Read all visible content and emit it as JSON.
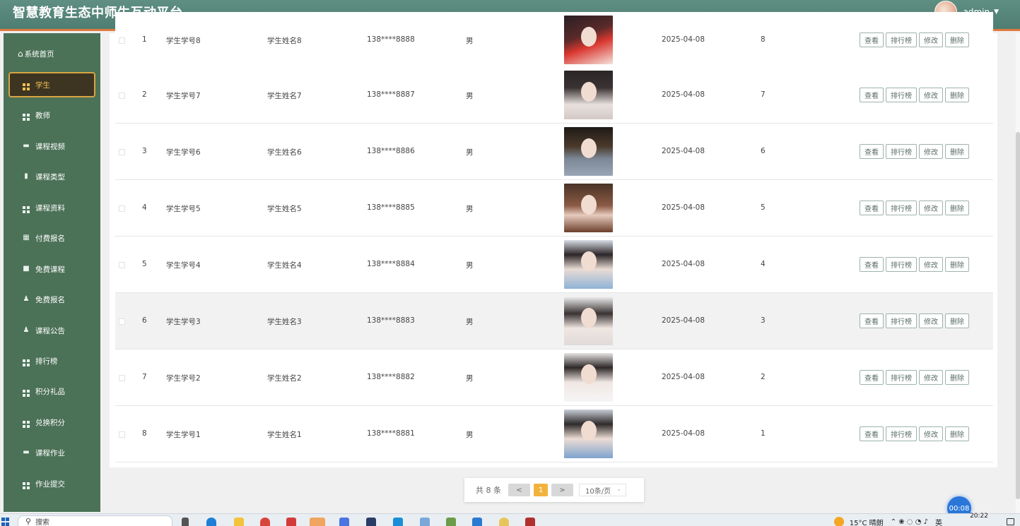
{
  "header": {
    "title": "智慧教育生态中师生互动平台",
    "username": "admin"
  },
  "sidebar": {
    "home": "系统首页",
    "items": [
      {
        "label": "学生",
        "icon": "grid-icon",
        "active": true
      },
      {
        "label": "教师",
        "icon": "grid-icon"
      },
      {
        "label": "课程视频",
        "icon": "briefcase-icon"
      },
      {
        "label": "课程类型",
        "icon": "clipboard-icon"
      },
      {
        "label": "课程资料",
        "icon": "grid-icon"
      },
      {
        "label": "付费报名",
        "icon": "table-icon"
      },
      {
        "label": "免费课程",
        "icon": "chat-icon"
      },
      {
        "label": "免费报名",
        "icon": "user-icon"
      },
      {
        "label": "课程公告",
        "icon": "user-icon"
      },
      {
        "label": "排行榜",
        "icon": "grid-icon"
      },
      {
        "label": "积分礼品",
        "icon": "grid-icon"
      },
      {
        "label": "兑换积分",
        "icon": "grid-icon"
      },
      {
        "label": "课程作业",
        "icon": "ticket-icon"
      },
      {
        "label": "作业提交",
        "icon": "grid-icon"
      }
    ]
  },
  "table": {
    "actions": {
      "view": "查看",
      "rank": "排行榜",
      "edit": "修改",
      "delete": "删除"
    },
    "rows": [
      {
        "index": "1",
        "student_no": "学生学号8",
        "name": "学生姓名8",
        "phone": "138****8888",
        "gender": "男",
        "date": "2025-04-08",
        "points": "8"
      },
      {
        "index": "2",
        "student_no": "学生学号7",
        "name": "学生姓名7",
        "phone": "138****8887",
        "gender": "男",
        "date": "2025-04-08",
        "points": "7"
      },
      {
        "index": "3",
        "student_no": "学生学号6",
        "name": "学生姓名6",
        "phone": "138****8886",
        "gender": "男",
        "date": "2025-04-08",
        "points": "6"
      },
      {
        "index": "4",
        "student_no": "学生学号5",
        "name": "学生姓名5",
        "phone": "138****8885",
        "gender": "男",
        "date": "2025-04-08",
        "points": "5"
      },
      {
        "index": "5",
        "student_no": "学生学号4",
        "name": "学生姓名4",
        "phone": "138****8884",
        "gender": "男",
        "date": "2025-04-08",
        "points": "4"
      },
      {
        "index": "6",
        "student_no": "学生学号3",
        "name": "学生姓名3",
        "phone": "138****8883",
        "gender": "男",
        "date": "2025-04-08",
        "points": "3"
      },
      {
        "index": "7",
        "student_no": "学生学号2",
        "name": "学生姓名2",
        "phone": "138****8882",
        "gender": "男",
        "date": "2025-04-08",
        "points": "2"
      },
      {
        "index": "8",
        "student_no": "学生学号1",
        "name": "学生姓名1",
        "phone": "138****8881",
        "gender": "男",
        "date": "2025-04-08",
        "points": "1"
      }
    ]
  },
  "pagination": {
    "total": "共 8 条",
    "prev": "<",
    "current": "1",
    "next": ">",
    "page_size": "10条/页"
  },
  "timer": "00:08",
  "taskbar": {
    "search": "搜索",
    "weather": "15°C 晴朗",
    "time": "20:22",
    "ime": "英"
  },
  "colors": {
    "header_bg": "#4f7d72",
    "header_border": "#e07a3c",
    "sidebar_bg": "#4b7157",
    "active_item": "#f3c152",
    "pager_current": "#f2b33d"
  }
}
